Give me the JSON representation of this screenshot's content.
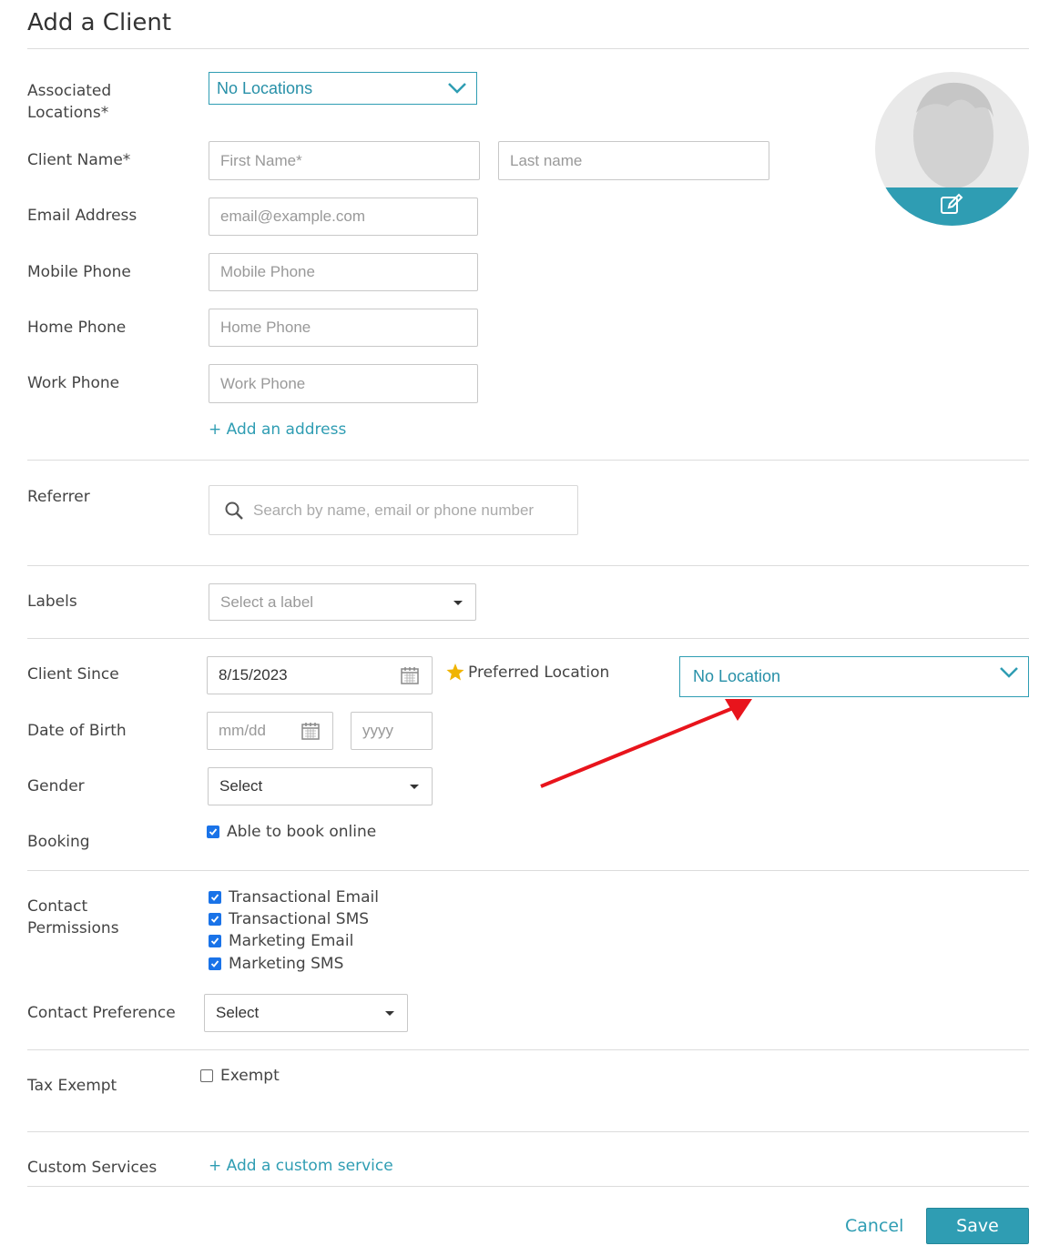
{
  "page_title": "Add a Client",
  "fields": {
    "associated_locations": {
      "label": "Associated\nLocations*",
      "value": "No Locations"
    },
    "client_name": {
      "label": "Client Name*",
      "first_placeholder": "First Name*",
      "last_placeholder": "Last name"
    },
    "email": {
      "label": "Email Address",
      "placeholder": "email@example.com"
    },
    "mobile_phone": {
      "label": "Mobile Phone",
      "placeholder": "Mobile Phone"
    },
    "home_phone": {
      "label": "Home Phone",
      "placeholder": "Home Phone"
    },
    "work_phone": {
      "label": "Work Phone",
      "placeholder": "Work Phone"
    },
    "add_address": "+ Add an address",
    "referrer": {
      "label": "Referrer",
      "placeholder": "Search by name, email or phone number"
    },
    "labels": {
      "label": "Labels",
      "placeholder": "Select a label"
    },
    "client_since": {
      "label": "Client Since",
      "value": "8/15/2023"
    },
    "preferred_location": {
      "label": "Preferred Location",
      "value": "No Location"
    },
    "date_of_birth": {
      "label": "Date of Birth",
      "md_placeholder": "mm/dd",
      "year_placeholder": "yyyy"
    },
    "gender": {
      "label": "Gender",
      "value": "Select"
    },
    "booking": {
      "label": "Booking",
      "option": "Able to book online",
      "checked": true
    },
    "contact_permissions": {
      "label": "Contact\nPermissions",
      "options": [
        {
          "label": "Transactional Email",
          "checked": true
        },
        {
          "label": "Transactional SMS",
          "checked": true
        },
        {
          "label": "Marketing Email",
          "checked": true
        },
        {
          "label": "Marketing SMS",
          "checked": true
        }
      ]
    },
    "contact_preference": {
      "label": "Contact Preference",
      "value": "Select"
    },
    "tax_exempt": {
      "label": "Tax Exempt",
      "option": "Exempt",
      "checked": false
    },
    "custom_services": {
      "label": "Custom Services",
      "link": "+ Add a custom service"
    }
  },
  "actions": {
    "cancel": "Cancel",
    "save": "Save"
  },
  "colors": {
    "accent": "#2f9db3",
    "checkbox": "#1a73e8",
    "annotation_arrow": "#e8141c",
    "star": "#f0b400"
  },
  "icons": [
    "chevron-down-icon",
    "calendar-icon",
    "search-icon",
    "star-icon",
    "edit-icon",
    "caret-down-icon"
  ]
}
